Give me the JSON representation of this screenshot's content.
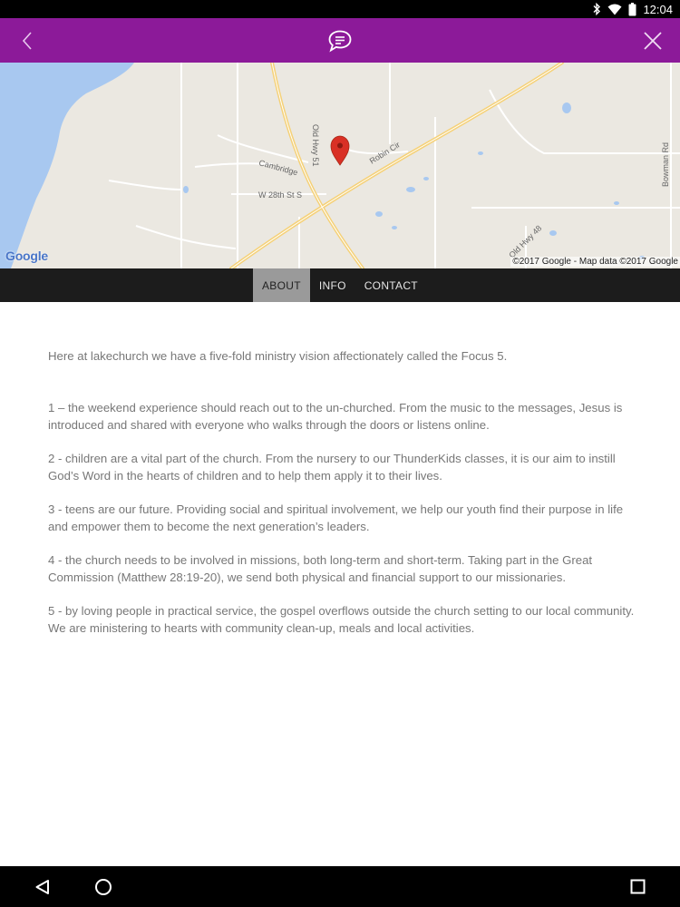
{
  "status_bar": {
    "time": "12:04",
    "icons": [
      "bluetooth-icon",
      "wifi-icon",
      "battery-icon"
    ]
  },
  "app_bar": {
    "background": "#8c1a99",
    "icons": [
      "back-chevron-icon",
      "chat-bubble-icon",
      "close-icon"
    ]
  },
  "map": {
    "street_labels": [
      "Old Hwy 51",
      "Robin Cir",
      "Cambridge",
      "W 28th St S",
      "Bowman Rd",
      "Old Hwy 48"
    ],
    "logo": "Google",
    "attribution": "©2017 Google - Map data ©2017 Google",
    "pin_color": "#d93025"
  },
  "tabs": [
    {
      "label": "ABOUT",
      "active": true
    },
    {
      "label": "INFO",
      "active": false
    },
    {
      "label": "CONTACT",
      "active": false
    }
  ],
  "content": {
    "intro": "Here at lakechurch we have a five-fold ministry vision affectionately called the Focus 5.",
    "paragraphs": [
      "1 – the weekend experience should reach out to the un-churched.  From the music to the messages, Jesus is introduced and shared with everyone who walks through the doors or listens online.",
      "2 - children are a vital part of the church.  From the nursery to our ThunderKids classes, it is our aim to instill God’s Word in the hearts of children and to help them apply it to their lives.",
      "3 - teens are our future.  Providing social and spiritual involvement, we help our youth find their purpose in life and empower them to become the next generation’s leaders.",
      "4 - the church needs to be involved in missions, both long-term and short-term.  Taking part in the Great Commission (Matthew 28:19-20), we send both physical and financial support to our missionaries.",
      "5 - by loving people in practical service, the gospel overflows outside the church setting to our local community.  We are ministering to hearts with community clean-up, meals and local activities."
    ]
  },
  "nav_bar": {
    "icons": [
      "nav-back-icon",
      "nav-home-icon",
      "nav-recents-icon"
    ]
  }
}
